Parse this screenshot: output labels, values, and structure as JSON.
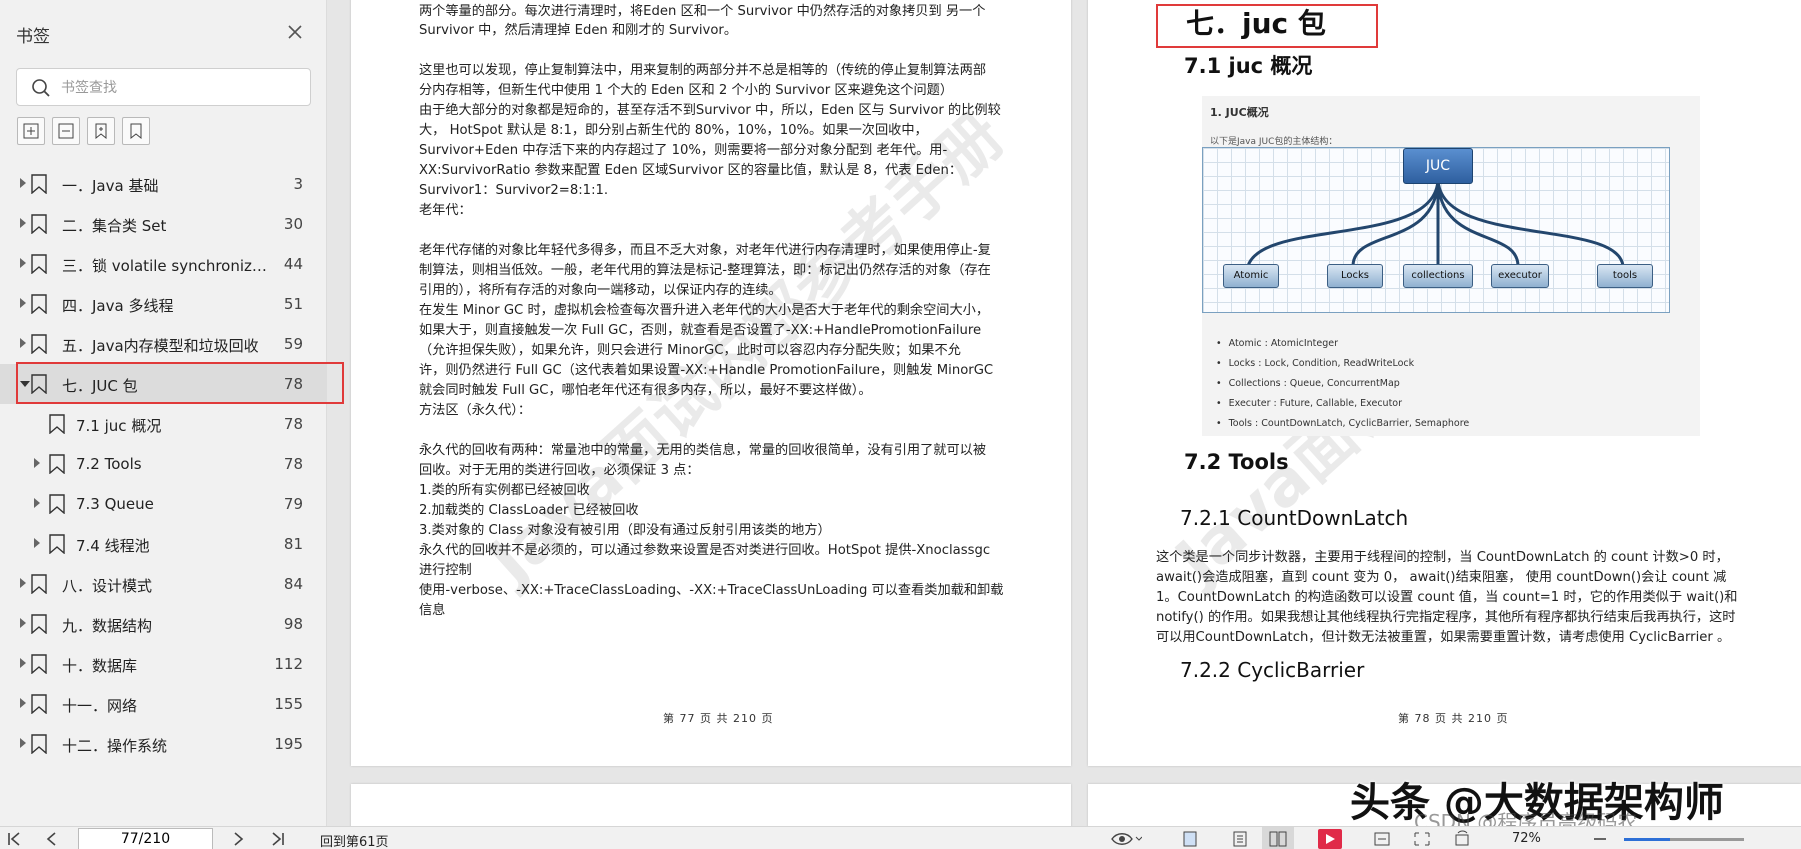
{
  "sidebar": {
    "title": "书签",
    "search_placeholder": "书签查找",
    "bookmarks": [
      {
        "label": "一．Java 基础",
        "page": "3"
      },
      {
        "label": "二．集合类 Set",
        "page": "30"
      },
      {
        "label": "三．锁 volatile synchronized...",
        "page": "44"
      },
      {
        "label": "四．Java 多线程",
        "page": "51"
      },
      {
        "label": "五．Java内存模型和垃圾回收",
        "page": "59"
      },
      {
        "label": "七．JUC 包",
        "page": "78"
      },
      {
        "label": "7.1 juc 概况",
        "page": "78"
      },
      {
        "label": "7.2 Tools",
        "page": "78"
      },
      {
        "label": "7.3 Queue",
        "page": "79"
      },
      {
        "label": "7.4 线程池",
        "page": "81"
      },
      {
        "label": "八．设计模式",
        "page": "84"
      },
      {
        "label": "九．数据结构",
        "page": "98"
      },
      {
        "label": "十．数据库",
        "page": "112"
      },
      {
        "label": "十一．网络",
        "page": "155"
      },
      {
        "label": "十二．操作系统",
        "page": "195"
      }
    ]
  },
  "left_page": {
    "lines": [
      "两个等量的部分。每次进行清理时，将Eden 区和一个 Survivor 中仍然存活的对象拷贝到 另一个",
      "Survivor 中，然后清理掉 Eden 和刚才的 Survivor。",
      "这里也可以发现，停止复制算法中，用来复制的两部分并不总是相等的（传统的停止复制算法两部",
      "分内存相等，但新生代中使用 1 个大的 Eden 区和 2 个小的 Survivor 区来避免这个问题）",
      "由于绝大部分的对象都是短命的，甚至存活不到Survivor 中，所以，Eden 区与 Survivor 的比例较",
      "大， HotSpot 默认是 8:1，即分别占新生代的 80%，10%，10%。如果一次回收中，",
      "Survivor+Eden 中存活下来的内存超过了 10%，则需要将一部分对象分配到 老年代。用-",
      "XX:SurvivorRatio 参数来配置 Eden 区域Survivor 区的容量比值，默认是 8，代表 Eden：",
      "Survivor1：Survivor2=8:1:1.",
      "老年代：",
      "老年代存储的对象比年轻代多得多，而且不乏大对象，对老年代进行内存清理时，如果使用停止-复",
      "制算法，则相当低效。一般，老年代用的算法是标记-整理算法，即：标记出仍然存活的对象（存在",
      "引用的），将所有存活的对象向一端移动，以保证内存的连续。",
      "在发生 Minor GC 时，虚拟机会检查每次晋升进入老年代的大小是否大于老年代的剩余空间大小，",
      "如果大于，则直接触发一次 Full GC，否则，就查看是否设置了-XX:+HandlePromotionFailure",
      "（允许担保失败），如果允许，则只会进行 MinorGC，此时可以容忍内存分配失败；如果不允",
      "许，则仍然进行 Full GC（这代表着如果设置-XX:+Handle PromotionFailure，则触发 MinorGC",
      "就会同时触发 Full GC，哪怕老年代还有很多内存，所以，最好不要这样做）。",
      "方法区（永久代）：",
      "永久代的回收有两种：常量池中的常量，无用的类信息，常量的回收很简单，没有引用了就可以被",
      "回收。对于无用的类进行回收，必须保证 3 点：",
      "1.类的所有实例都已经被回收",
      "2.加载类的 ClassLoader 已经被回收",
      "3.类对象的 Class 对象没有被引用（即没有通过反射引用该类的地方）",
      "永久代的回收并不是必须的，可以通过参数来设置是否对类进行回收。HotSpot 提供-Xnoclassgc",
      "进行控制",
      "使用-verbose、-XX:+TraceClassLoading、-XX:+TraceClassUnLoading 可以查看类加载和卸载",
      "信息"
    ],
    "footer": "第 77 页 共 210 页"
  },
  "right_page": {
    "h1": "七．juc 包",
    "h2_1": "7.1 juc 概况",
    "figure": {
      "title": "1. JUC概况",
      "subtitle": "以下是Java JUC包的主体结构：",
      "root": "JUC",
      "children": [
        "Atomic",
        "Locks",
        "collections",
        "executor",
        "tools"
      ],
      "bullets": [
        "Atomic : AtomicInteger",
        "Locks : Lock, Condition, ReadWriteLock",
        "Collections : Queue, ConcurrentMap",
        "Executer : Future, Callable, Executor",
        "Tools : CountDownLatch, CyclicBarrier, Semaphore"
      ]
    },
    "h2_2": "7.2 Tools",
    "h3_1": "7.2.1 CountDownLatch",
    "para": [
      "这个类是一个同步计数器，主要用于线程间的控制，当 CountDownLatch 的 count 计数>0 时，",
      "await()会造成阻塞，直到 count 变为 0， await()结束阻塞， 使用 countDown()会让 count 减",
      "1。CountDownLatch 的构造函数可以设置 count 值，当 count=1 时，它的作用类似于 wait()和",
      "notify() 的作用。如果我想让其他线程执行完指定程序，其他所有程序都执行结束后我再执行，这时",
      "可以用CountDownLatch，但计数无法被重置，如果需要重置计数，请考虑使用 CyclicBarrier 。"
    ],
    "h3_2": "7.2.2 CyclicBarrier",
    "footer": "第 78 页 共 210 页"
  },
  "statusbar": {
    "page_value": "77/210",
    "go_back": "回到第61页",
    "zoom": "72%",
    "zoom_fraction": 0.38
  },
  "overlay": {
    "watermark_main": "头条 @大数据架构师",
    "watermark_sub": "CSDN @程序员高级码农"
  },
  "colors": {
    "highlight_box": "#e03a3a",
    "zoom_accent": "#2d6fd6"
  }
}
